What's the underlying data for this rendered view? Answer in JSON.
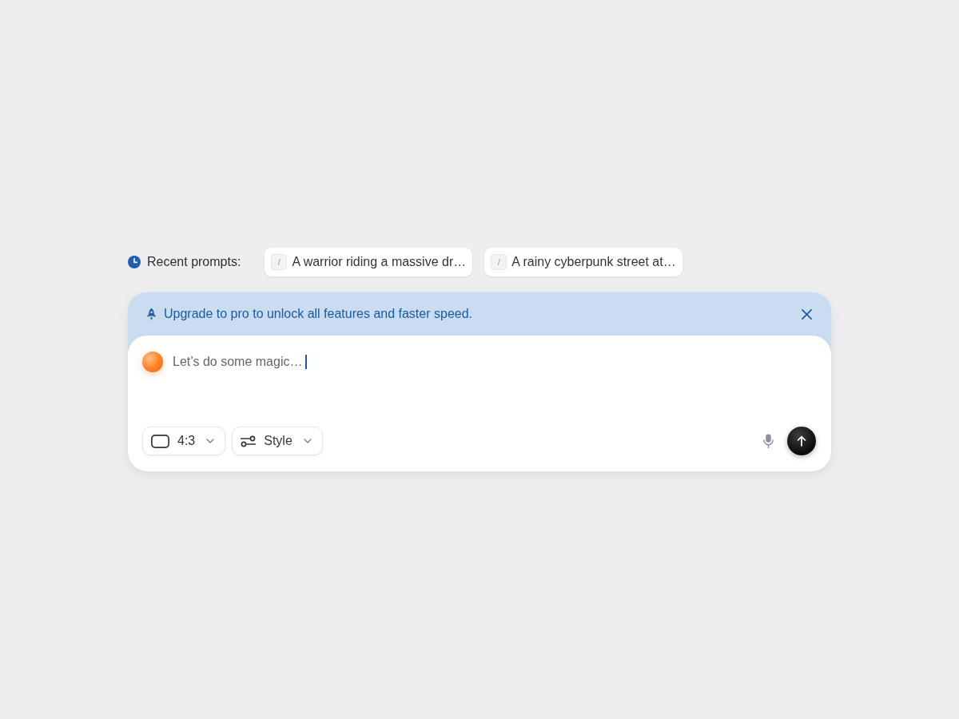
{
  "recent_prompts": {
    "label": "Recent prompts:",
    "items": [
      {
        "key": "/",
        "text": "A warrior riding a massive dr…"
      },
      {
        "key": "/",
        "text": "A rainy cyberpunk street at…"
      }
    ]
  },
  "composer": {
    "banner": {
      "text": "Upgrade to pro to unlock all features and faster speed."
    },
    "prompt_input": {
      "value": "Let’s do some magic…"
    },
    "options": [
      {
        "kind": "aspect",
        "label": "4:3"
      },
      {
        "kind": "style",
        "label": "Style"
      }
    ]
  }
}
